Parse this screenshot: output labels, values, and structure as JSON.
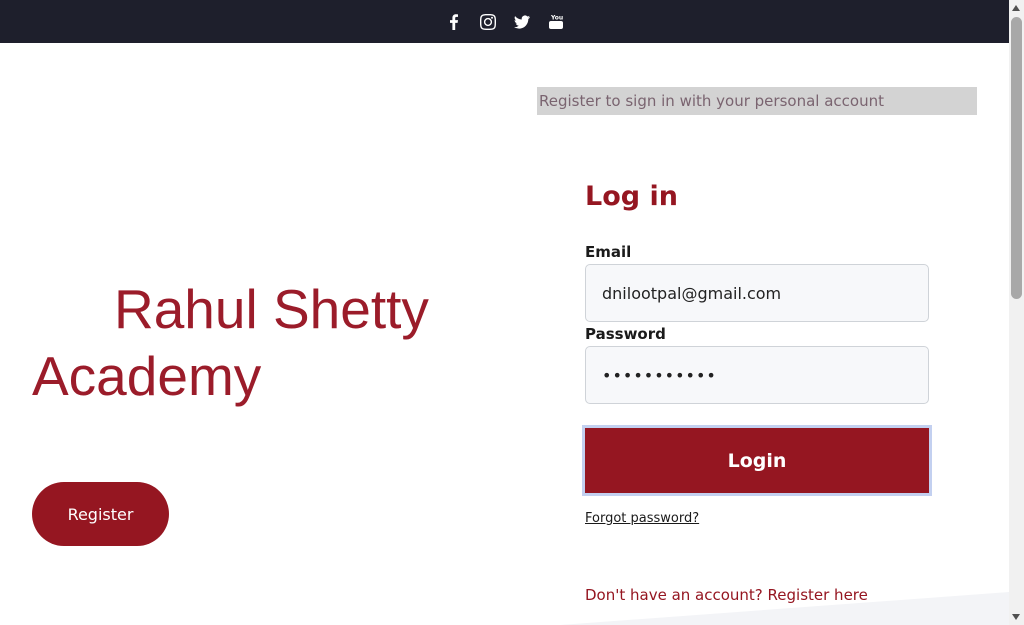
{
  "social": {
    "icons": [
      "facebook-icon",
      "instagram-icon",
      "twitter-icon",
      "youtube-icon"
    ]
  },
  "brand": {
    "title": "Rahul Shetty Academy",
    "color": "#9b1c2a"
  },
  "hero": {
    "register_label": "Register"
  },
  "banner": {
    "text": "Register to sign in with your personal account"
  },
  "login": {
    "title": "Log in",
    "email_label": "Email",
    "email_value": "dnilootpal@gmail.com",
    "password_label": "Password",
    "password_value": "•••••••••••",
    "submit_label": "Login",
    "forgot_label": "Forgot password?",
    "register_prompt": "Don't have an account? Register here",
    "accent": "#951621"
  }
}
